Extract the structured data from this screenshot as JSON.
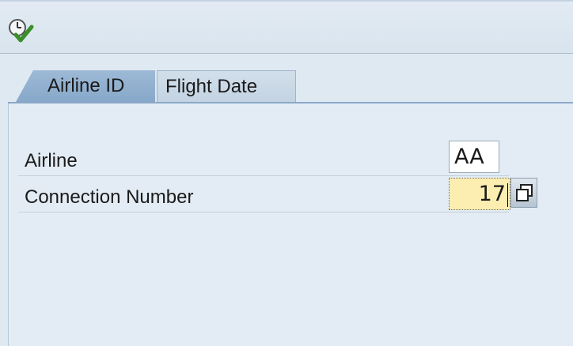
{
  "toolbar": {
    "execute_icon": "clock-check-icon"
  },
  "tabs": [
    {
      "label": "Airline ID",
      "active": true
    },
    {
      "label": "Flight Date",
      "active": false
    }
  ],
  "form": {
    "airline": {
      "label": "Airline",
      "value": "AA"
    },
    "connection": {
      "label": "Connection Number",
      "value": "17",
      "help_icon": "value-help-icon"
    }
  },
  "colors": {
    "active_tab": "#8eaecf",
    "focused_field": "#fbeeb0",
    "background": "#dfe9f2"
  }
}
